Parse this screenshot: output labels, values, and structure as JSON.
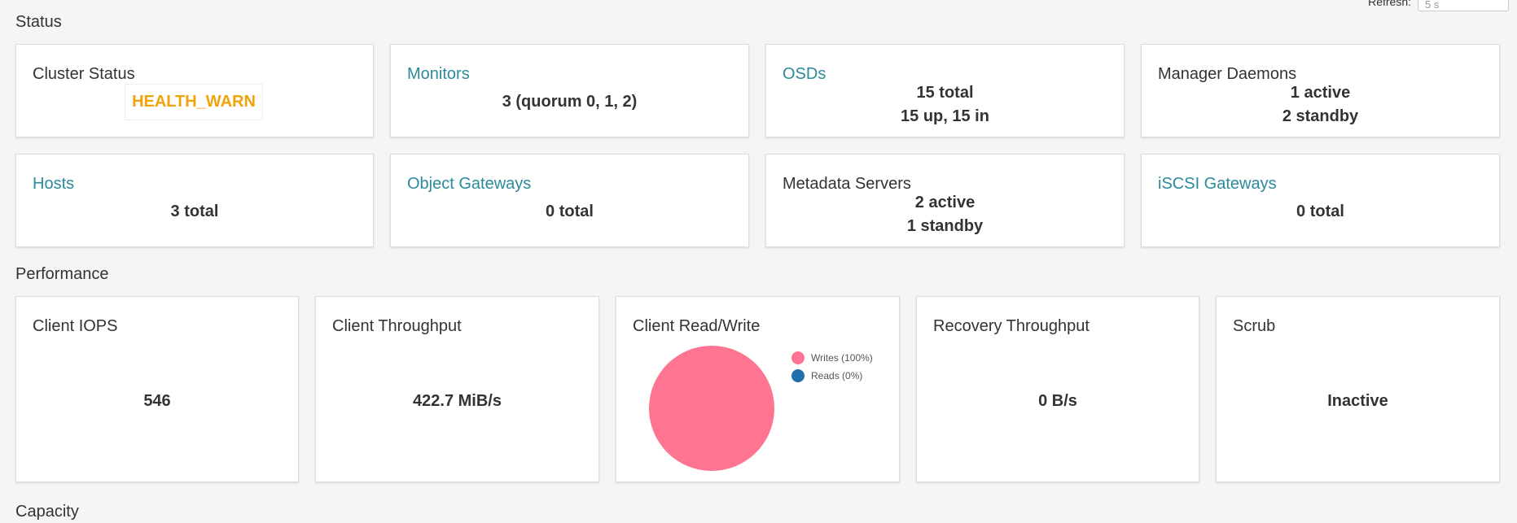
{
  "header": {
    "refresh_label": "Refresh:",
    "refresh_value": "5 s"
  },
  "sections": {
    "status": "Status",
    "performance": "Performance",
    "capacity": "Capacity"
  },
  "status": {
    "cluster_status": {
      "title": "Cluster Status",
      "value": "HEALTH_WARN"
    },
    "monitors": {
      "title": "Monitors",
      "value": "3 (quorum 0, 1, 2)"
    },
    "osds": {
      "title": "OSDs",
      "line1": "15 total",
      "line2": "15 up, 15 in"
    },
    "manager_daemons": {
      "title": "Manager Daemons",
      "line1": "1 active",
      "line2": "2 standby"
    },
    "hosts": {
      "title": "Hosts",
      "value": "3 total"
    },
    "object_gateways": {
      "title": "Object Gateways",
      "value": "0 total"
    },
    "metadata_servers": {
      "title": "Metadata Servers",
      "line1": "2 active",
      "line2": "1 standby"
    },
    "iscsi_gateways": {
      "title": "iSCSI Gateways",
      "value": "0 total"
    }
  },
  "performance": {
    "client_iops": {
      "title": "Client IOPS",
      "value": "546"
    },
    "client_throughput": {
      "title": "Client Throughput",
      "value": "422.7 MiB/s"
    },
    "client_read_write": {
      "title": "Client Read/Write",
      "legend_writes": "Writes (100%)",
      "legend_reads": "Reads (0%)"
    },
    "recovery_throughput": {
      "title": "Recovery Throughput",
      "value": "0 B/s"
    },
    "scrub": {
      "title": "Scrub",
      "value": "Inactive"
    }
  },
  "chart_data": {
    "type": "pie",
    "categories": [
      "Writes (100%)",
      "Reads (0%)"
    ],
    "values": [
      100,
      0
    ],
    "colors": [
      "#ff7591",
      "#1f6fa8"
    ],
    "title": "Client Read/Write",
    "legend": "right"
  },
  "colors": {
    "link": "#2b8a9b",
    "health_warn": "#f0a30a",
    "writes": "#ff7591",
    "reads": "#1f6fa8"
  }
}
